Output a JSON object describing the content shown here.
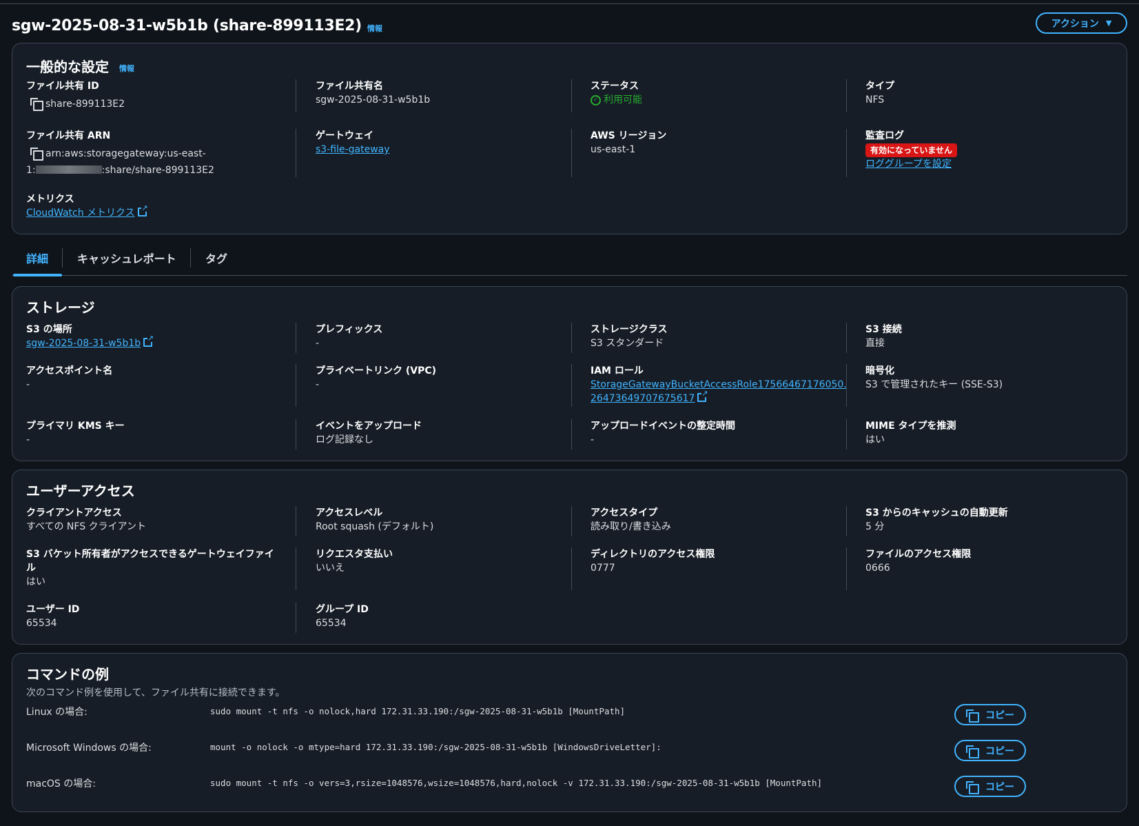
{
  "header": {
    "title": "sgw-2025-08-31-w5b1b (share-899113E2)",
    "info_label": "情報",
    "action_label": "アクション"
  },
  "general": {
    "title": "一般的な設定",
    "info_label": "情報",
    "file_share_id_label": "ファイル共有 ID",
    "file_share_id_value": "share-899113E2",
    "file_share_name_label": "ファイル共有名",
    "file_share_name_value": "sgw-2025-08-31-w5b1b",
    "status_label": "ステータス",
    "status_value": "利用可能",
    "type_label": "タイプ",
    "type_value": "NFS",
    "arn_label": "ファイル共有 ARN",
    "arn_line1": "arn:aws:storagegateway:us-east-",
    "arn_line2_prefix": "1:",
    "arn_line2_suffix": ":share/share-899113E2",
    "gateway_label": "ゲートウェイ",
    "gateway_value": "s3-file-gateway",
    "region_label": "AWS リージョン",
    "region_value": "us-east-1",
    "audit_log_label": "監査ログ",
    "audit_log_badge": "有効になっていません",
    "audit_log_link": "ロググループを設定",
    "metrics_label": "メトリクス",
    "metrics_link": "CloudWatch メトリクス"
  },
  "tabs": [
    {
      "label": "詳細",
      "active": true
    },
    {
      "label": "キャッシュレポート",
      "active": false
    },
    {
      "label": "タグ",
      "active": false
    }
  ],
  "storage": {
    "title": "ストレージ",
    "s3_location_label": "S3 の場所",
    "s3_location_value": "sgw-2025-08-31-w5b1b",
    "prefix_label": "プレフィックス",
    "prefix_value": "-",
    "storage_class_label": "ストレージクラス",
    "storage_class_value": "S3 スタンダード",
    "s3_connection_label": "S3 接続",
    "s3_connection_value": "直接",
    "access_point_label": "アクセスポイント名",
    "access_point_value": "-",
    "private_link_label": "プライベートリンク (VPC)",
    "private_link_value": "-",
    "iam_role_label": "IAM ロール",
    "iam_role_line1": "StorageGatewayBucketAccessRole17566467176050.",
    "iam_role_line2": "26473649707675617",
    "encryption_label": "暗号化",
    "encryption_value": "S3 で管理されたキー (SSE-S3)",
    "kms_key_label": "プライマリ KMS キー",
    "kms_key_value": "-",
    "upload_event_label": "イベントをアップロード",
    "upload_event_value": "ログ記録なし",
    "upload_settle_label": "アップロードイベントの整定時間",
    "upload_settle_value": "-",
    "mime_label": "MIME タイプを推測",
    "mime_value": "はい"
  },
  "user_access": {
    "title": "ユーザーアクセス",
    "client_access_label": "クライアントアクセス",
    "client_access_value": "すべての NFS クライアント",
    "access_level_label": "アクセスレベル",
    "access_level_value": "Root squash (デフォルト)",
    "access_type_label": "アクセスタイプ",
    "access_type_value": "読み取り/書き込み",
    "cache_refresh_label": "S3 からのキャッシュの自動更新",
    "cache_refresh_value": "5 分",
    "bucket_owner_label_line1": "S3 バケット所有者がアクセスできるゲートウェイファイ",
    "bucket_owner_label_line2": "ル",
    "bucket_owner_value": "はい",
    "requester_pays_label": "リクエスタ支払い",
    "requester_pays_value": "いいえ",
    "dir_perm_label": "ディレクトリのアクセス権限",
    "dir_perm_value": "0777",
    "file_perm_label": "ファイルのアクセス権限",
    "file_perm_value": "0666",
    "user_id_label": "ユーザー ID",
    "user_id_value": "65534",
    "group_id_label": "グループ ID",
    "group_id_value": "65534"
  },
  "commands": {
    "title": "コマンドの例",
    "description": "次のコマンド例を使用して、ファイル共有に接続できます。",
    "copy_label": "コピー",
    "items": [
      {
        "label": "Linux の場合:",
        "command": "sudo mount -t nfs -o nolock,hard 172.31.33.190:/sgw-2025-08-31-w5b1b [MountPath]"
      },
      {
        "label": "Microsoft Windows の場合:",
        "command": "mount -o nolock -o mtype=hard 172.31.33.190:/sgw-2025-08-31-w5b1b [WindowsDriveLetter]:"
      },
      {
        "label": "macOS の場合:",
        "command": "sudo mount -t nfs -o vers=3,rsize=1048576,wsize=1048576,hard,nolock -v 172.31.33.190:/sgw-2025-08-31-w5b1b [MountPath]"
      }
    ]
  },
  "colors": {
    "background": "#0f141a",
    "panel": "#161d26",
    "accent": "#42b4ff",
    "success": "#29ad32",
    "danger": "#d91515"
  }
}
